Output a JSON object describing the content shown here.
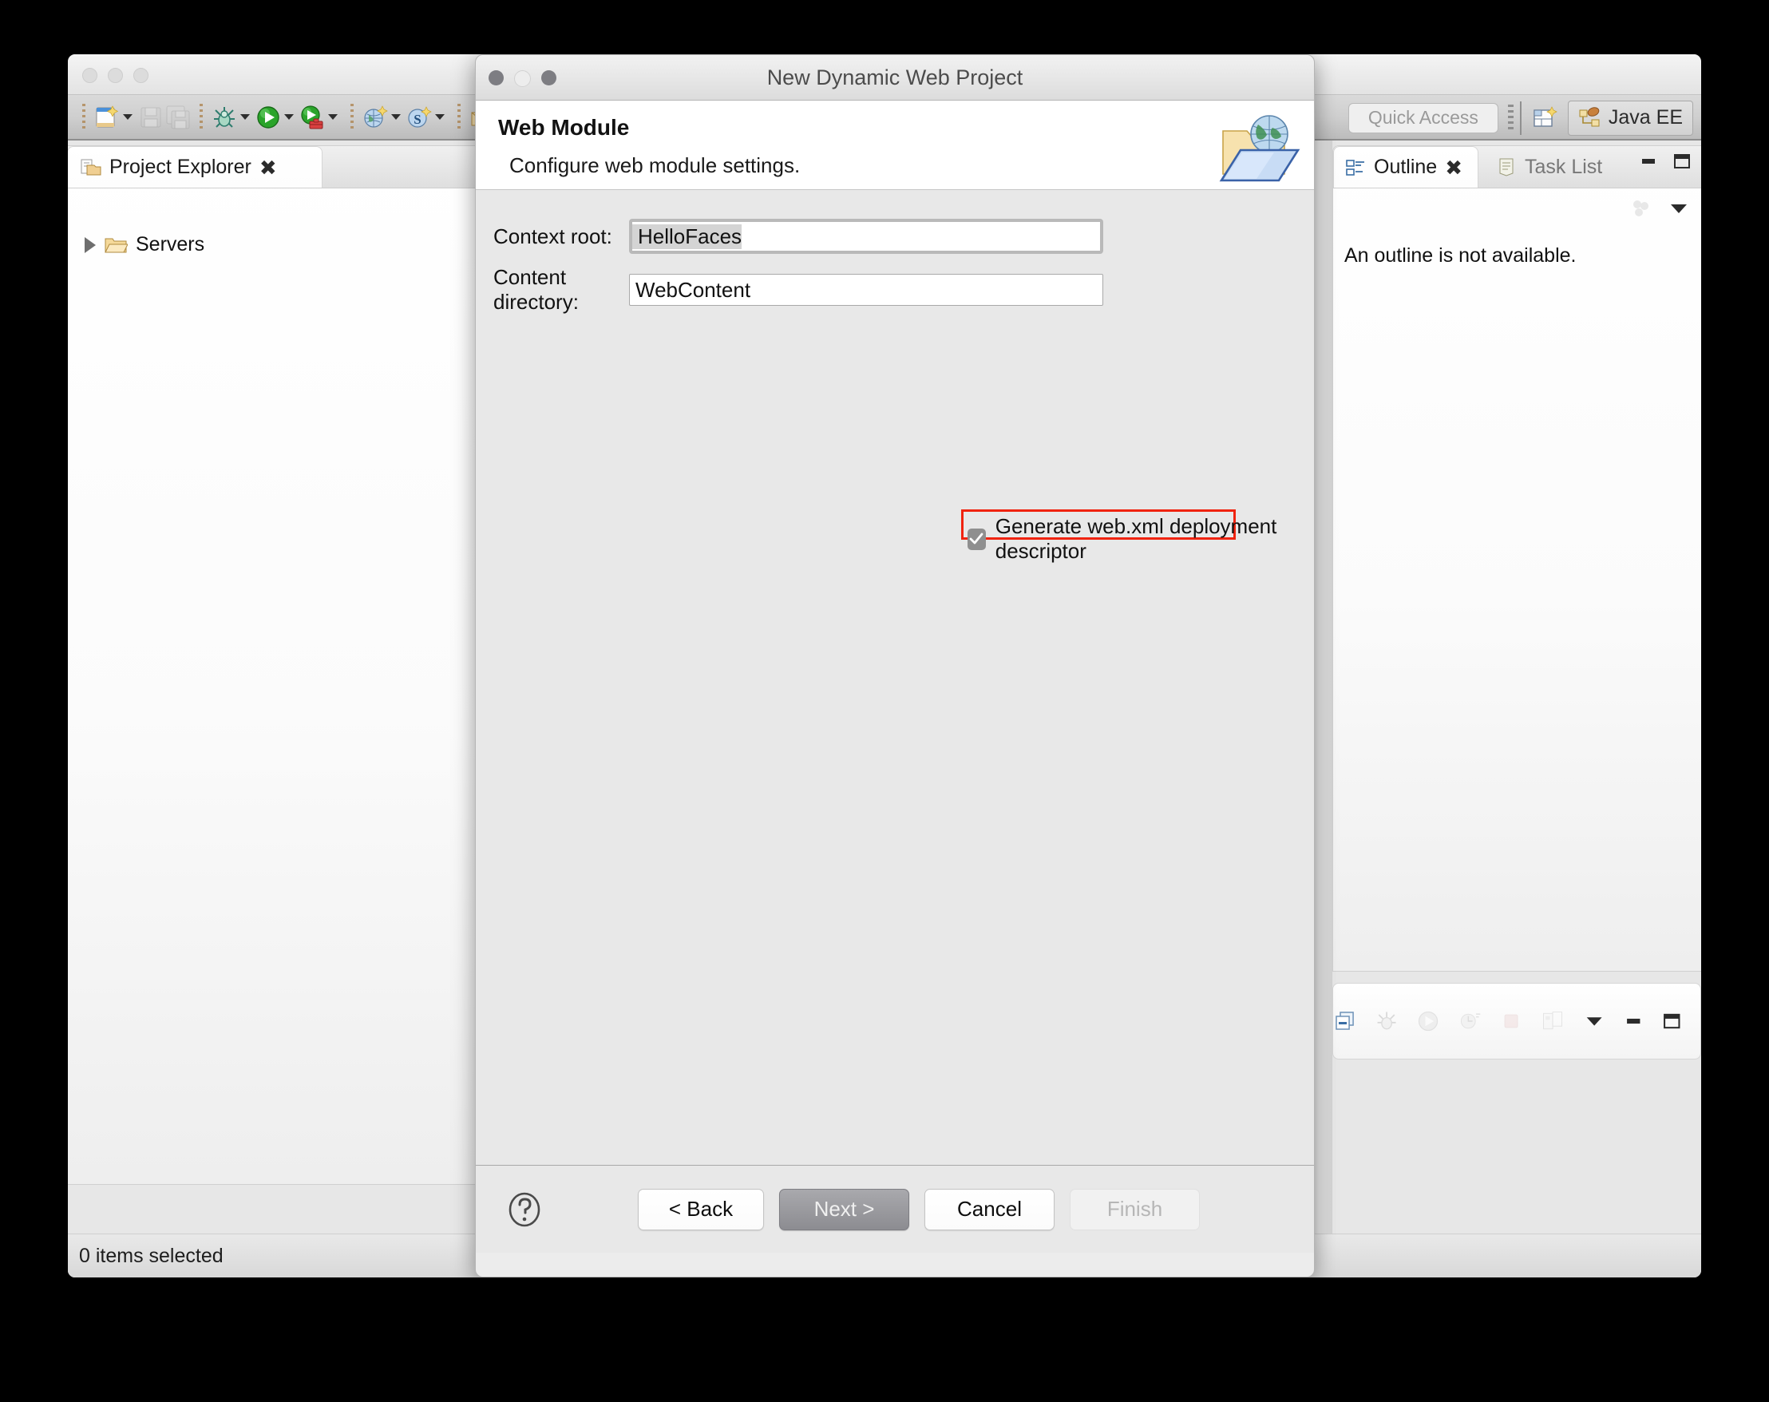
{
  "ide": {
    "toolbar": {
      "items": [
        {
          "name": "new-wizard-icon",
          "label": "New",
          "enabled": true,
          "has_dropdown": true
        },
        {
          "name": "save-icon",
          "label": "Save",
          "enabled": false,
          "has_dropdown": false
        },
        {
          "name": "save-all-icon",
          "label": "Save All",
          "enabled": false,
          "has_dropdown": false
        },
        {
          "name": "debug-icon",
          "label": "Debug",
          "enabled": true,
          "has_dropdown": true
        },
        {
          "name": "run-icon",
          "label": "Run",
          "enabled": true,
          "has_dropdown": true
        },
        {
          "name": "run-on-server-icon",
          "label": "Run on Server",
          "enabled": true,
          "has_dropdown": true
        },
        {
          "name": "new-server-icon",
          "label": "New Server",
          "enabled": true,
          "has_dropdown": true
        },
        {
          "name": "search-icon",
          "label": "Search",
          "enabled": true,
          "has_dropdown": true
        },
        {
          "name": "open-type-icon",
          "label": "Open Type",
          "enabled": true,
          "has_dropdown": false
        }
      ]
    },
    "quick_access": {
      "placeholder": "Quick Access"
    },
    "perspective": {
      "open_perspective_icon": "open-perspective-icon",
      "active_label": "Java EE"
    },
    "project_explorer": {
      "tab_label": "Project Explorer",
      "close_glyph": "✖",
      "tools": [
        {
          "name": "collapse-all-icon"
        },
        {
          "name": "link-with-editor-icon"
        },
        {
          "name": "view-menu-icon"
        },
        {
          "name": "view-dropdown-icon"
        }
      ],
      "minimize_glyph": "▬",
      "maximize_glyph": "▢",
      "tree": [
        {
          "label": "Servers",
          "expandable": true,
          "icon": "folder-icon"
        }
      ]
    },
    "outline_panel": {
      "tabs": [
        {
          "label": "Outline",
          "active": true,
          "icon": "outline-icon",
          "close_glyph": "✖"
        },
        {
          "label": "Task List",
          "active": false,
          "icon": "task-list-icon"
        }
      ],
      "empty_message": "An outline is not available.",
      "minimize_glyph": "▬",
      "maximize_glyph": "▢",
      "tools": [
        {
          "name": "view-menu-icon"
        },
        {
          "name": "view-dropdown-icon"
        }
      ]
    },
    "servers_toolbar": {
      "items": [
        {
          "name": "collapse-all-icon",
          "enabled": true
        },
        {
          "name": "debug-server-icon",
          "enabled": false
        },
        {
          "name": "start-server-icon",
          "enabled": false
        },
        {
          "name": "profile-server-icon",
          "enabled": false
        },
        {
          "name": "stop-server-icon",
          "enabled": false
        },
        {
          "name": "publish-server-icon",
          "enabled": false
        },
        {
          "name": "view-dropdown-icon",
          "enabled": true
        },
        {
          "name": "minimize-icon",
          "enabled": true
        },
        {
          "name": "maximize-icon",
          "enabled": true
        }
      ]
    },
    "status_bar": {
      "text": "0 items selected"
    }
  },
  "dialog": {
    "window_title": "New Dynamic Web Project",
    "header": {
      "title": "Web Module",
      "subtitle": "Configure web module settings.",
      "icon": "web-folder-globe-icon"
    },
    "fields": [
      {
        "label": "Context root:",
        "value": "HelloFaces",
        "focused": true,
        "selected": true
      },
      {
        "label": "Content directory:",
        "value": "WebContent",
        "focused": false,
        "selected": false
      }
    ],
    "checkbox": {
      "label": "Generate web.xml deployment descriptor",
      "checked": true,
      "highlight_color": "#f0230f",
      "check_glyph": "✓"
    },
    "footer": {
      "help_label": "?",
      "buttons": [
        {
          "label": "< Back",
          "style": "normal",
          "enabled": true
        },
        {
          "label": "Next >",
          "style": "default",
          "enabled": true
        },
        {
          "label": "Cancel",
          "style": "normal",
          "enabled": true
        },
        {
          "label": "Finish",
          "style": "disabled",
          "enabled": false
        }
      ]
    }
  }
}
